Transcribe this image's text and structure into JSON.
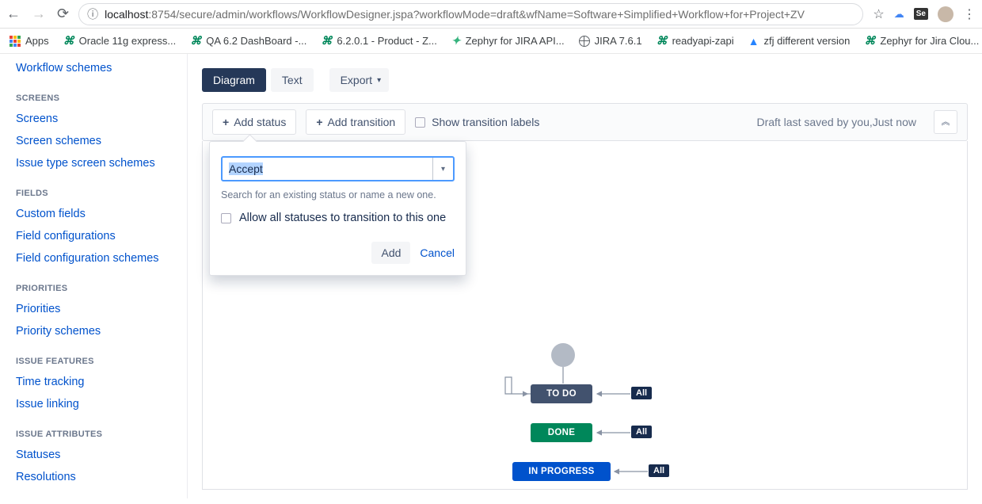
{
  "browser": {
    "url_host": "localhost",
    "url_rest": ":8754/secure/admin/workflows/WorkflowDesigner.jspa?workflowMode=draft&wfName=Software+Simplified+Workflow+for+Project+ZV",
    "bookmarks": {
      "apps": "Apps",
      "oracle": "Oracle 11g express...",
      "qa": "QA 6.2 DashBoard -...",
      "product": "6.2.0.1 - Product - Z...",
      "zephyr_api": "Zephyr for JIRA API...",
      "jira": "JIRA 7.6.1",
      "readyapi": "readyapi-zapi",
      "zfj": "zfj different version",
      "zcloud": "Zephyr for Jira Clou...",
      "more": "»"
    }
  },
  "sidebar": {
    "workflow_schemes": "Workflow schemes",
    "screens_head": "SCREENS",
    "screens": "Screens",
    "screen_schemes": "Screen schemes",
    "issue_type_screen_schemes": "Issue type screen schemes",
    "fields_head": "FIELDS",
    "custom_fields": "Custom fields",
    "field_configs": "Field configurations",
    "field_config_schemes": "Field configuration schemes",
    "priorities_head": "PRIORITIES",
    "priorities": "Priorities",
    "priority_schemes": "Priority schemes",
    "issue_features_head": "ISSUE FEATURES",
    "time_tracking": "Time tracking",
    "issue_linking": "Issue linking",
    "issue_attrs_head": "ISSUE ATTRIBUTES",
    "statuses": "Statuses",
    "resolutions": "Resolutions"
  },
  "tabs": {
    "diagram": "Diagram",
    "text": "Text",
    "export": "Export"
  },
  "toolbar": {
    "add_status": "Add status",
    "add_transition": "Add transition",
    "show_labels": "Show transition labels",
    "draft_status": "Draft last saved by you,Just now"
  },
  "popover": {
    "input_value": "Accept",
    "help": "Search for an existing status or name a new one.",
    "checkbox_label": "Allow all statuses to transition to this one",
    "add": "Add",
    "cancel": "Cancel"
  },
  "workflow": {
    "todo": "TO DO",
    "done": "DONE",
    "in_progress": "IN PROGRESS",
    "all": "All"
  }
}
